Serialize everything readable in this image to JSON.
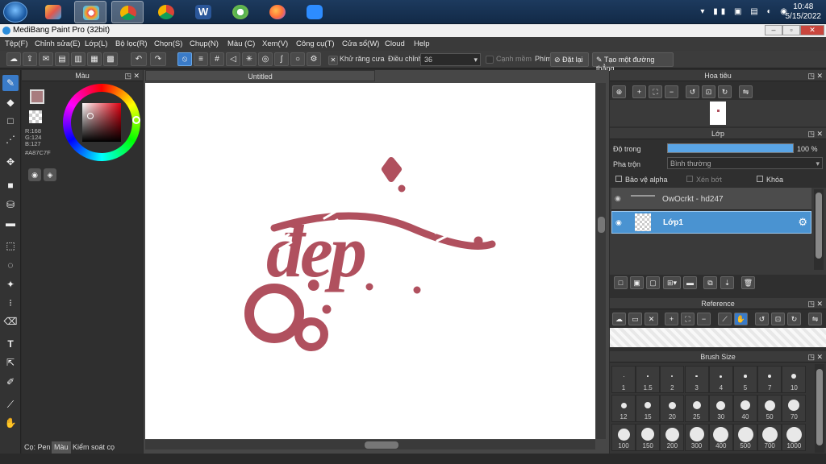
{
  "taskbar": {
    "apps": [
      "windows-explorer",
      "paint",
      "medibang",
      "chrome-profile",
      "chrome",
      "word",
      "coccoc",
      "firefox",
      "zoom"
    ],
    "time": "10:48",
    "date": "5/15/2022"
  },
  "window": {
    "title": "MediBang Paint Pro (32bit)"
  },
  "menu": [
    "Tệp(F)",
    "Chỉnh sửa(E)",
    "Lớp(L)",
    "Bộ lọc(R)",
    "Chọn(S)",
    "Chụp(N)",
    "Màu (C)",
    "Xem(V)",
    "Công cụ(T)",
    "Cửa sổ(W)",
    "Cloud",
    "Help"
  ],
  "toolbar": {
    "antialias_label": "Khử răng cưa",
    "adjust_label": "Điều chỉnh",
    "adjust_value": "36",
    "edge_label": "Cạnh mềm",
    "key_label": "Phím",
    "reset_label": "Đặt lại",
    "line_label": "Tạo một đường thẳng"
  },
  "color_panel": {
    "title": "Màu",
    "r": "R:168",
    "g": "G:124",
    "b": "B:127",
    "hex": "#A87C7F",
    "foreground": "#a87c7f",
    "tabs": [
      "Cọ: Pen",
      "Màu",
      "Kiểm soát cọ"
    ]
  },
  "canvas": {
    "doc_title": "Untitled",
    "artwork_text": "đẹp",
    "ink_color": "#b0505e"
  },
  "navigator": {
    "title": "Hoa tiêu"
  },
  "layers": {
    "title": "Lớp",
    "opacity_label": "Độ trong",
    "opacity_value": "100 %",
    "opacity": 1.0,
    "blend_label": "Pha trộn",
    "blend_value": "Bình thường",
    "protect_alpha": "Bảo vệ alpha",
    "clipping": "Xén bớt",
    "lock": "Khóa",
    "items": [
      {
        "name": "OwOcrkt - hd247",
        "selected": false
      },
      {
        "name": "Lớp1",
        "selected": true
      }
    ]
  },
  "reference": {
    "title": "Reference"
  },
  "brush_size": {
    "title": "Brush Size",
    "sizes": [
      "1",
      "1.5",
      "2",
      "3",
      "4",
      "5",
      "7",
      "10",
      "12",
      "15",
      "20",
      "25",
      "30",
      "40",
      "50",
      "70",
      "100",
      "150",
      "200",
      "300",
      "400",
      "500",
      "700",
      "1000"
    ]
  }
}
